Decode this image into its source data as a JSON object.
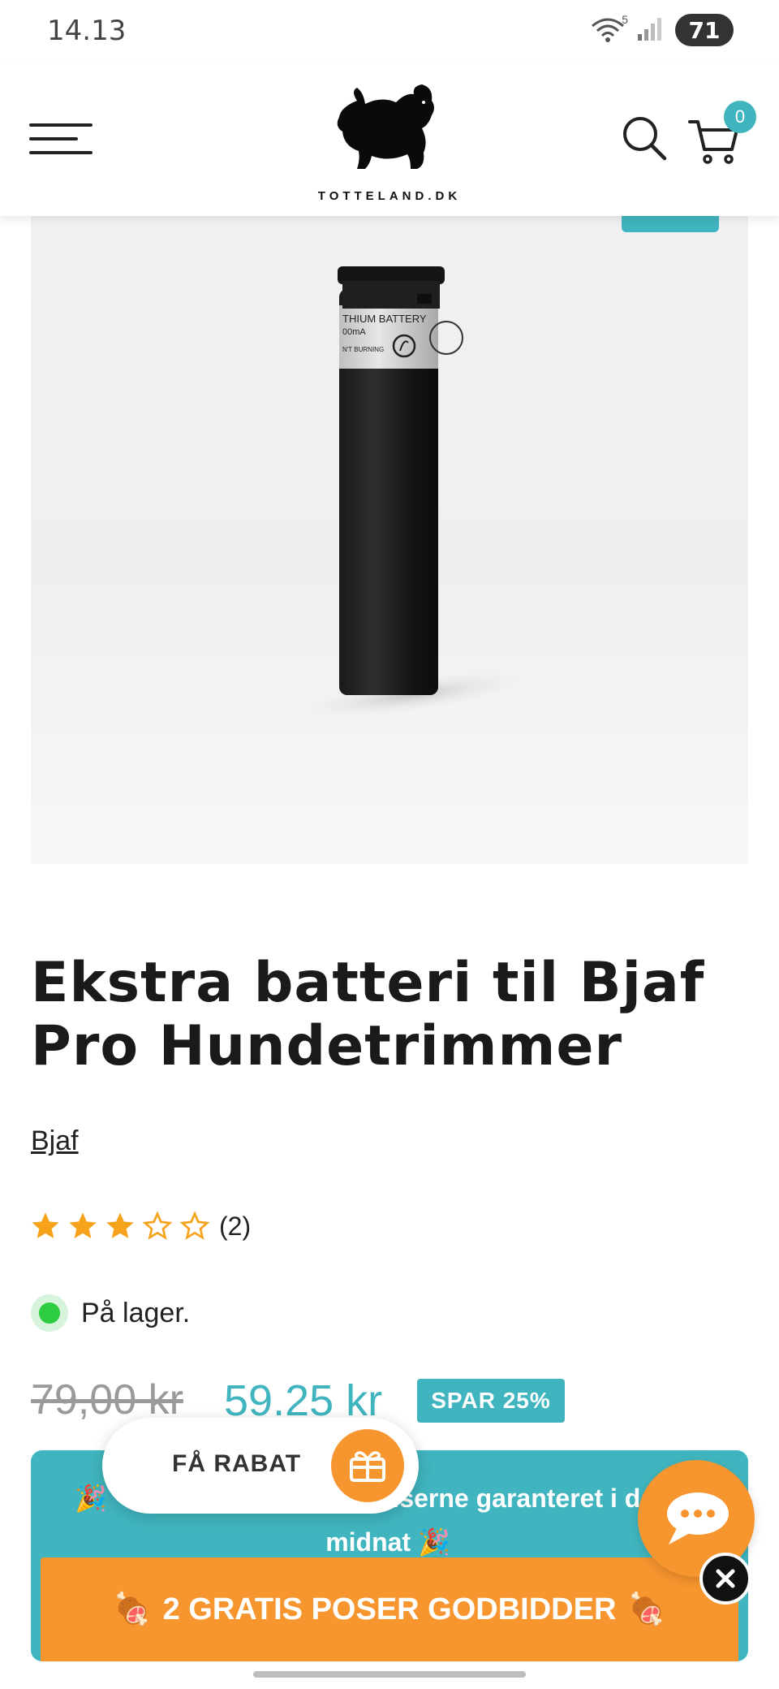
{
  "status_bar": {
    "time": "14.13",
    "wifi_label": "5",
    "battery": "71"
  },
  "header": {
    "logo_text": "TOTTELAND.DK",
    "cart_count": "0"
  },
  "product": {
    "title": "Ekstra batteri til Bjaf Pro Hundetrimmer",
    "brand": "Bjaf",
    "rating": 3,
    "rating_max": 5,
    "review_count": "(2)",
    "stock_text": "På lager.",
    "old_price": "79,00 kr",
    "new_price": "59.25 kr",
    "save_badge": "SPAR 25%",
    "battery_label_line1": "THIUM BATTERY",
    "battery_label_line2": "00mA",
    "battery_label_line3": "N'T BURNING"
  },
  "promo": {
    "text_right": "Priserne garanteret i dag til",
    "text_line2": "midnat",
    "party_emoji": "🎉",
    "offer_label": "2 GRATIS POSER GODBIDDER",
    "offer_emoji": "🍖"
  },
  "discount_popup": {
    "label": "FÅ RABAT"
  },
  "colors": {
    "accent": "#40b5bf",
    "orange": "#f7952e",
    "star": "#f7a21b"
  }
}
